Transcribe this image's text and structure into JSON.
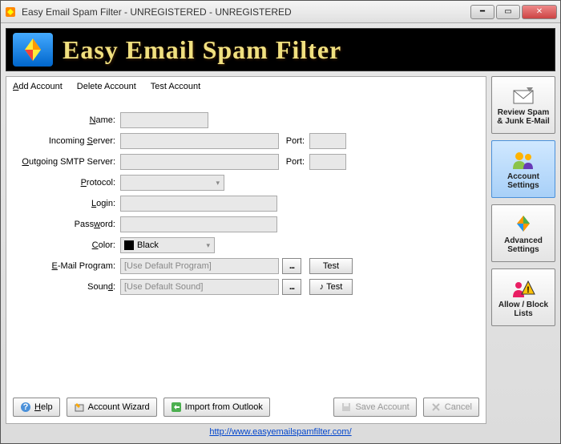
{
  "window": {
    "title": "Easy Email Spam Filter - UNREGISTERED - UNREGISTERED"
  },
  "banner": {
    "title": "Easy Email Spam Filter"
  },
  "toolbar": {
    "add_account": "Add Account",
    "delete_account": "Delete Account",
    "test_account": "Test Account"
  },
  "form": {
    "labels": {
      "name": "Name:",
      "incoming": "Incoming Server:",
      "outgoing": "Outgoing SMTP Server:",
      "port": "Port:",
      "protocol": "Protocol:",
      "login": "Login:",
      "password": "Password:",
      "color": "Color:",
      "email_program": "E-Mail Program:",
      "sound": "Sound:"
    },
    "values": {
      "name": "",
      "incoming": "",
      "outgoing": "",
      "port_in": "",
      "port_out": "",
      "protocol": "",
      "login": "",
      "password": "",
      "color_name": "Black",
      "color_hex": "#000000"
    },
    "placeholders": {
      "email_program": "[Use Default Program]",
      "sound": "[Use Default Sound]"
    },
    "buttons": {
      "browse": "...",
      "test": "Test"
    }
  },
  "bottom": {
    "help": "Help",
    "wizard": "Account Wizard",
    "import": "Import from Outlook",
    "save": "Save Account",
    "cancel": "Cancel"
  },
  "sidebar": {
    "review": "Review Spam & Junk E-Mail",
    "account": "Account Settings",
    "advanced": "Advanced Settings",
    "allow": "Allow / Block Lists"
  },
  "footer": {
    "url": "http://www.easyemailspamfilter.com/"
  }
}
